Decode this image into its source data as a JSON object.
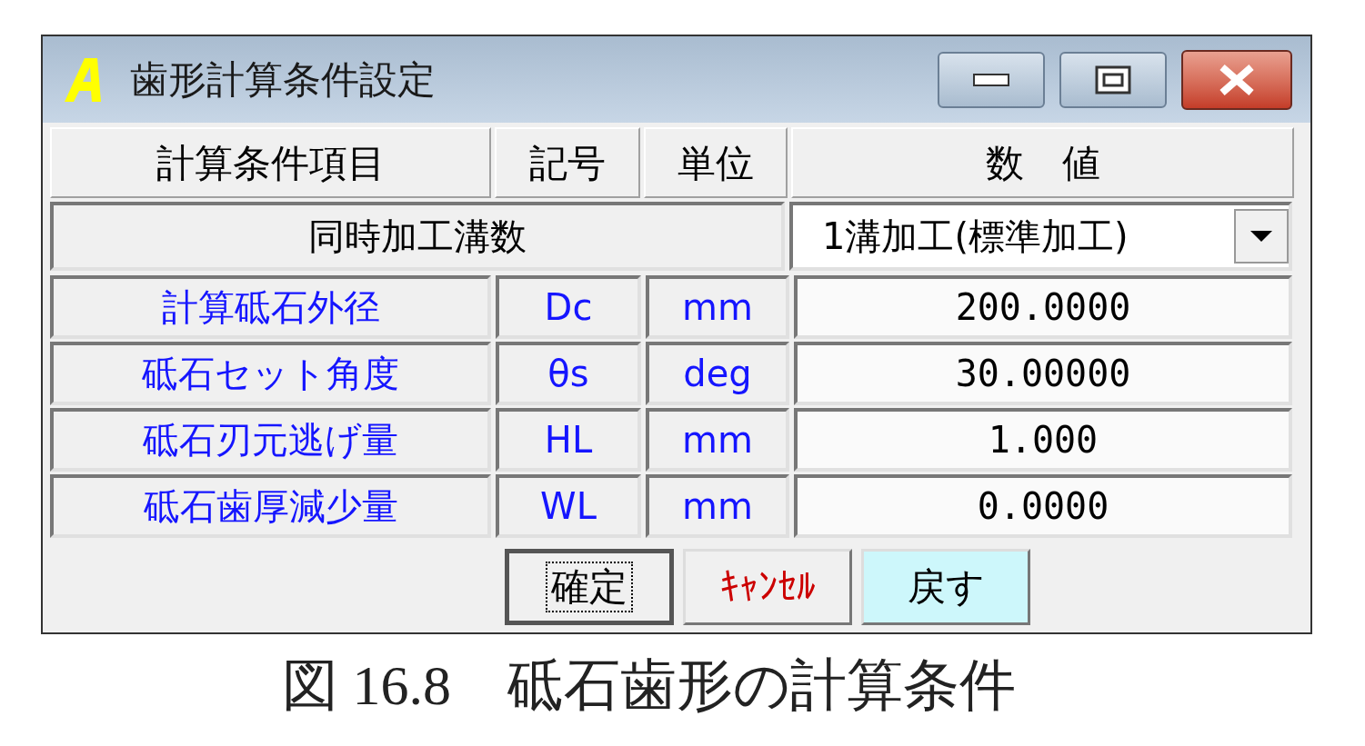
{
  "window": {
    "title": "歯形計算条件設定"
  },
  "table": {
    "columns": [
      "計算条件項目",
      "記号",
      "単位",
      "数　値"
    ],
    "mode_row": {
      "label": "同時加工溝数",
      "value": "1溝加工(標準加工)"
    },
    "rows": [
      {
        "item": "計算砥石外径",
        "symbol": "Dc",
        "unit": "mm",
        "value": "200.0000"
      },
      {
        "item": "砥石セット角度",
        "symbol": "θs",
        "unit": "deg",
        "value": "30.00000"
      },
      {
        "item": "砥石刃元逃げ量",
        "symbol": "HL",
        "unit": "mm",
        "value": "1.000"
      },
      {
        "item": "砥石歯厚減少量",
        "symbol": "WL",
        "unit": "mm",
        "value": "0.0000"
      }
    ]
  },
  "buttons": [
    {
      "label": "確定",
      "kind": "confirm",
      "focused": true
    },
    {
      "label": "ｷｬﾝｾﾙ",
      "kind": "cancel",
      "focused": false
    },
    {
      "label": "戻す",
      "kind": "reset",
      "focused": false
    }
  ],
  "caption": "図 16.8　砥石歯形の計算条件"
}
